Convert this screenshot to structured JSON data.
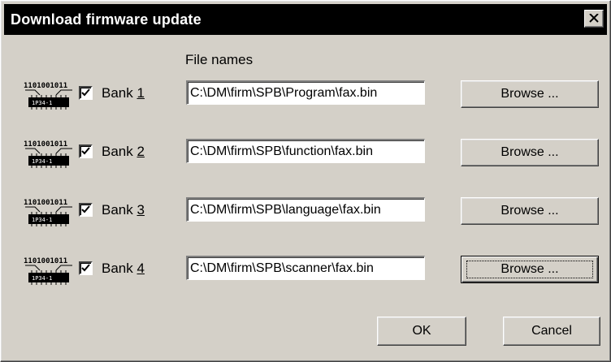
{
  "window": {
    "title": "Download firmware update",
    "close_icon": "close-icon"
  },
  "files_heading": "File names",
  "banks": [
    {
      "prefix": "Bank ",
      "number": "1",
      "checked": true,
      "file": "C:\\DM\\firm\\SPB\\Program\\fax.bin",
      "browse_label": "Browse ...",
      "icon": "memory-chip-icon"
    },
    {
      "prefix": "Bank ",
      "number": "2",
      "checked": true,
      "file": "C:\\DM\\firm\\SPB\\function\\fax.bin",
      "browse_label": "Browse ...",
      "icon": "memory-chip-icon"
    },
    {
      "prefix": "Bank ",
      "number": "3",
      "checked": true,
      "file": "C:\\DM\\firm\\SPB\\language\\fax.bin",
      "browse_label": "Browse ...",
      "icon": "memory-chip-icon"
    },
    {
      "prefix": "Bank ",
      "number": "4",
      "checked": true,
      "file": "C:\\DM\\firm\\SPB\\scanner\\fax.bin",
      "browse_label": "Browse ...",
      "icon": "memory-chip-icon"
    }
  ],
  "buttons": {
    "ok_label": "OK",
    "cancel_label": "Cancel"
  },
  "chip_text": "1101001011",
  "colors": {
    "titlebar": "#000000",
    "dialog_face": "#d4d0c8",
    "input_bg": "#ffffff"
  }
}
